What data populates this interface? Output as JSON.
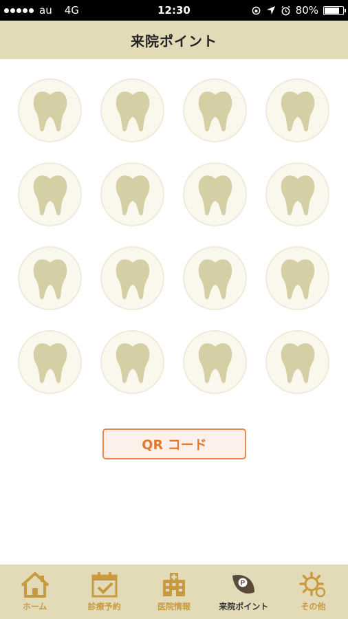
{
  "status_bar": {
    "carrier": "au",
    "network": "4G",
    "time": "12:30",
    "battery_percent_label": "80%",
    "battery_level": 0.8
  },
  "header": {
    "title": "来院ポイント"
  },
  "stamps": {
    "total": 16,
    "collected": 0,
    "icon": "tooth-icon",
    "colors": {
      "circle_fill": "#faf8ec",
      "tooth": "#d4cfa4"
    }
  },
  "qr_button": {
    "label": "QR コード"
  },
  "tab_bar": {
    "items": [
      {
        "label": "ホーム",
        "icon": "home-icon",
        "active": false
      },
      {
        "label": "診療予約",
        "icon": "calendar-check-icon",
        "active": false
      },
      {
        "label": "医院情報",
        "icon": "hospital-icon",
        "active": false
      },
      {
        "label": "来院ポイント",
        "icon": "point-leaf-icon",
        "active": true
      },
      {
        "label": "その他",
        "icon": "gear-icon",
        "active": false
      }
    ]
  },
  "colors": {
    "header_bg": "#e3dbb8",
    "accent_orange": "#e48a4c",
    "tab_label": "#c89a40"
  }
}
